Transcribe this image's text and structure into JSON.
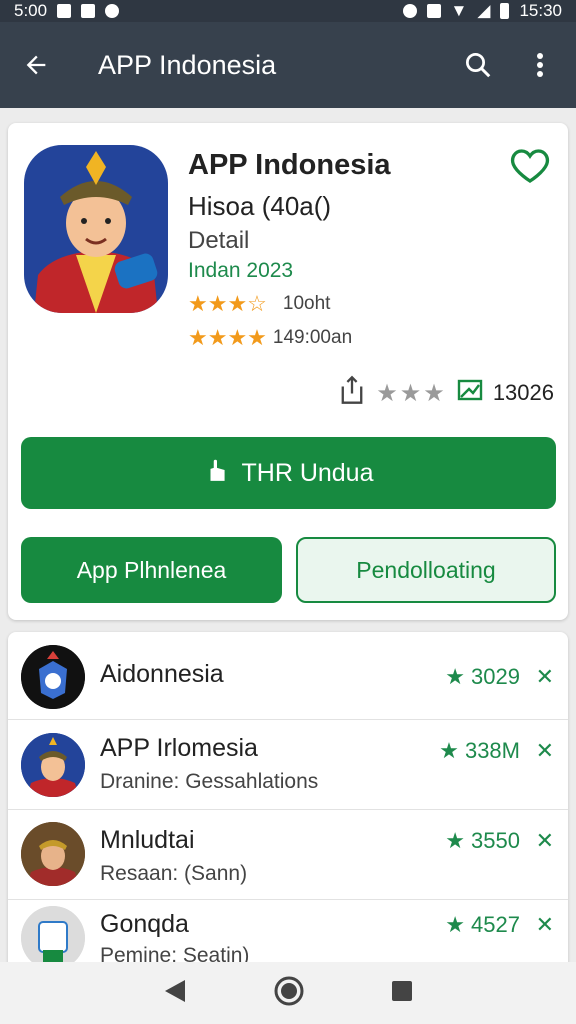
{
  "status_bar": {
    "time_left": "5:00",
    "time_right": "15:30"
  },
  "app_bar": {
    "title": "APP Indonesia",
    "icons": [
      "back-arrow-icon",
      "search-icon",
      "more-vert-icon"
    ]
  },
  "app_card": {
    "name": "APP Indonesia",
    "subtitle": "Hisoa (40a()",
    "detail": "Detail",
    "date": "Indan 2023",
    "rating_1": {
      "stars": 3.5,
      "text": "10oht"
    },
    "rating_2": {
      "stars": 4,
      "text": "149:00an"
    },
    "meta_count": "13026",
    "install_label": "THR Undua",
    "button_primary": "App Plhnlenea",
    "button_secondary": "Pendolloating"
  },
  "list": [
    {
      "name": "Aidonnesia",
      "desc": "",
      "count": "3029"
    },
    {
      "name": "APP Irlomesia",
      "desc": "Dranine: Gessahlations",
      "count": "338M"
    },
    {
      "name": "Mnludtai",
      "desc": "Resaan: (Sann)",
      "count": "3550"
    },
    {
      "name": "Gonqda",
      "desc": "Pemine: Seatin)",
      "count": "4527"
    }
  ],
  "colors": {
    "primary": "#178a40",
    "appbar": "#37414d",
    "star": "#f29a1b"
  }
}
